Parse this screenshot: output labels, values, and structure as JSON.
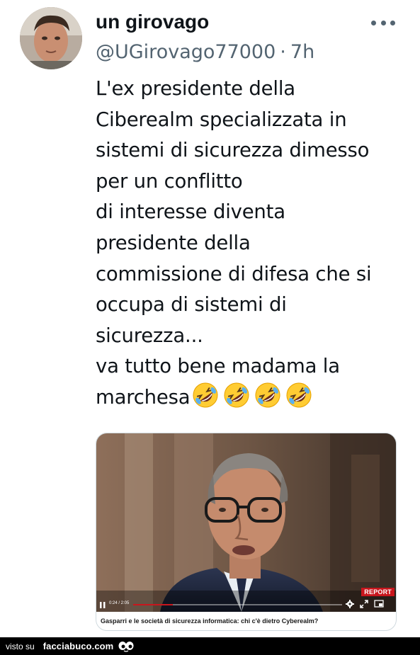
{
  "tweet": {
    "author_name": "un girovago",
    "handle": "@UGirovago77000",
    "separator": "·",
    "time": "7h",
    "more_icon": "more-horizontal-icon",
    "text_lines": [
      "L'ex presidente della",
      "Ciberealm specializzata in",
      "sistemi di sicurezza dimesso",
      "per un conflitto",
      "di interesse diventa",
      "presidente della",
      "commissione di difesa che si",
      "occupa di sistemi di",
      "sicurezza...",
      "va tutto bene madama la",
      "marchesa"
    ],
    "emoji": "rolling-on-floor-laughing",
    "emoji_count": 4
  },
  "media": {
    "badge": "REPORT",
    "time": "0:24 / 2:05",
    "progress": 0.19,
    "caption": "Gasparri e le società di sicurezza informatica: chi c'è dietro Cyberealm?",
    "accent_color": "#c8161d"
  },
  "footer": {
    "prefix": "visto su",
    "site": "facciabuco.com",
    "logo_icon": "eyes-icon"
  },
  "colors": {
    "text": "#0f1419",
    "secondary": "#536471",
    "border": "#cfd9de",
    "footer_bg": "#000000"
  }
}
